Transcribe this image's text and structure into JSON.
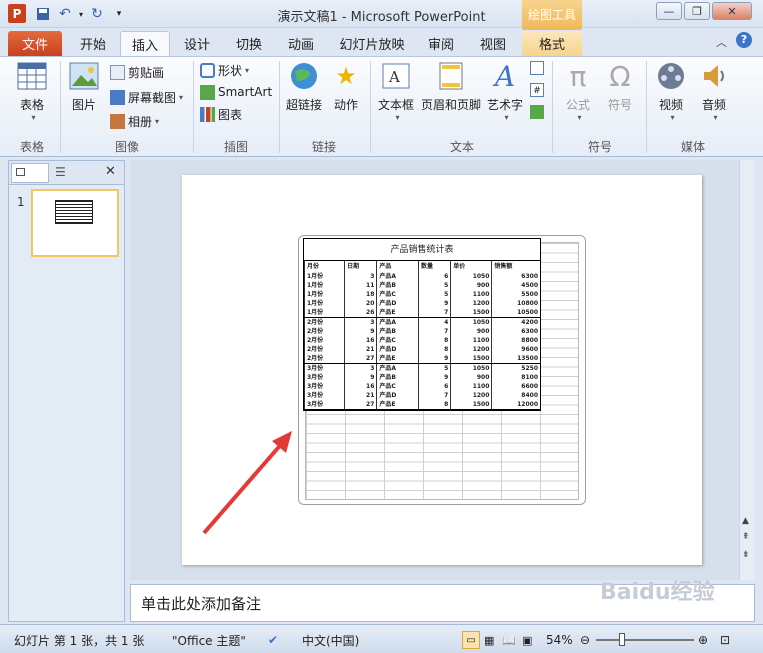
{
  "window": {
    "title": "演示文稿1 - Microsoft PowerPoint",
    "contextual_tab_group": "绘图工具"
  },
  "tabs": [
    "文件",
    "开始",
    "插入",
    "设计",
    "切换",
    "动画",
    "幻灯片放映",
    "审阅",
    "视图",
    "格式"
  ],
  "ribbon": {
    "table": {
      "label": "表格",
      "group": "表格"
    },
    "images": {
      "picture": "图片",
      "clipart": "剪贴画",
      "screenshot": "屏幕截图",
      "album": "相册",
      "group": "图像"
    },
    "illustrations": {
      "shapes": "形状",
      "smartart": "SmartArt",
      "chart": "图表",
      "group": "插图"
    },
    "links": {
      "hyperlink": "超链接",
      "action": "动作",
      "group": "链接"
    },
    "text": {
      "textbox": "文本框",
      "header_footer": "页眉和页脚",
      "wordart": "艺术字",
      "group": "文本"
    },
    "symbols": {
      "equation": "公式",
      "symbol": "符号",
      "group": "符号"
    },
    "media": {
      "video": "视频",
      "audio": "音频",
      "group": "媒体"
    }
  },
  "slide_panel": {
    "number": "1"
  },
  "slide_table": {
    "title": "产品销售统计表",
    "headers": [
      "月份",
      "日期",
      "产品",
      "数量",
      "单价",
      "销售额"
    ],
    "rows": [
      [
        "1月份",
        "3",
        "产品A",
        "6",
        "1050",
        "6300"
      ],
      [
        "1月份",
        "11",
        "产品B",
        "5",
        "900",
        "4500"
      ],
      [
        "1月份",
        "18",
        "产品C",
        "5",
        "1100",
        "5500"
      ],
      [
        "1月份",
        "20",
        "产品D",
        "9",
        "1200",
        "10800"
      ],
      [
        "1月份",
        "26",
        "产品E",
        "7",
        "1500",
        "10500"
      ],
      [
        "2月份",
        "3",
        "产品A",
        "4",
        "1050",
        "4200"
      ],
      [
        "2月份",
        "9",
        "产品B",
        "7",
        "900",
        "6300"
      ],
      [
        "2月份",
        "16",
        "产品C",
        "8",
        "1100",
        "8800"
      ],
      [
        "2月份",
        "21",
        "产品D",
        "8",
        "1200",
        "9600"
      ],
      [
        "2月份",
        "27",
        "产品E",
        "9",
        "1500",
        "13500"
      ],
      [
        "3月份",
        "3",
        "产品A",
        "5",
        "1050",
        "5250"
      ],
      [
        "3月份",
        "9",
        "产品B",
        "9",
        "900",
        "8100"
      ],
      [
        "3月份",
        "16",
        "产品C",
        "6",
        "1100",
        "6600"
      ],
      [
        "3月份",
        "21",
        "产品D",
        "7",
        "1200",
        "8400"
      ],
      [
        "3月份",
        "27",
        "产品E",
        "8",
        "1500",
        "12000"
      ]
    ]
  },
  "notes_placeholder": "单击此处添加备注",
  "status": {
    "slide_info": "幻灯片 第 1 张，共 1 张",
    "theme": "\"Office 主题\"",
    "language": "中文(中国)",
    "zoom": "54%"
  },
  "watermark": "Baidu经验",
  "colors": {
    "file_tab": "#c9401e",
    "contextual": "#f0b85a",
    "ribbon_bg": "#e6edf7",
    "arrow": "#e53935"
  }
}
